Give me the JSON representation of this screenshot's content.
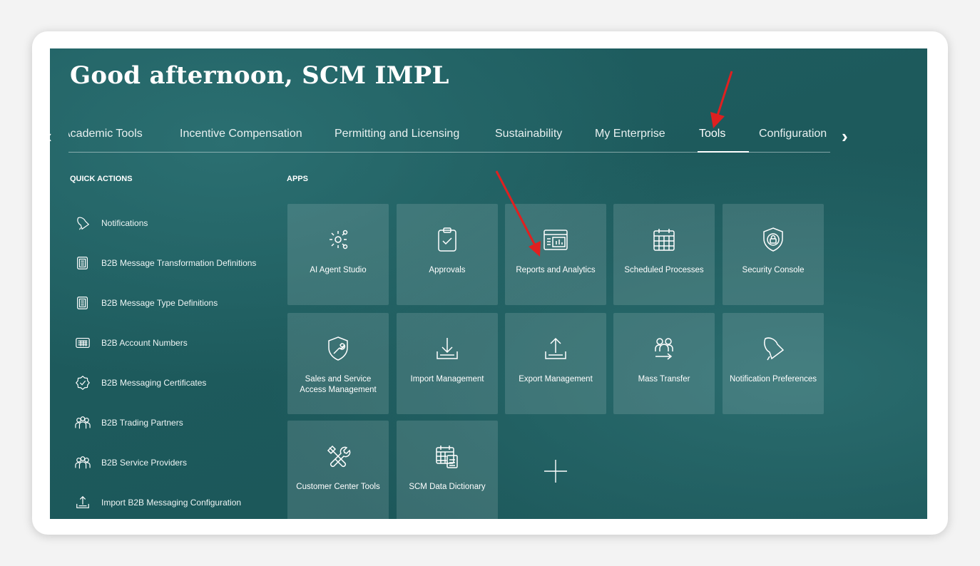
{
  "greeting": "Good afternoon, SCM IMPL",
  "tabs": [
    {
      "label": "Academic Tools"
    },
    {
      "label": "Incentive Compensation"
    },
    {
      "label": "Permitting and Licensing"
    },
    {
      "label": "Sustainability"
    },
    {
      "label": "My Enterprise"
    },
    {
      "label": "Tools",
      "active": true
    },
    {
      "label": "Configuration"
    }
  ],
  "quick_actions": {
    "heading": "QUICK ACTIONS",
    "items": [
      {
        "label": "Notifications",
        "icon": "bell-icon"
      },
      {
        "label": "B2B Message Transformation Definitions",
        "icon": "document-stack-icon"
      },
      {
        "label": "B2B Message Type Definitions",
        "icon": "document-stack-icon"
      },
      {
        "label": "B2B Account Numbers",
        "icon": "keypad-icon"
      },
      {
        "label": "B2B Messaging Certificates",
        "icon": "certificate-badge-icon"
      },
      {
        "label": "B2B Trading Partners",
        "icon": "people-group-icon"
      },
      {
        "label": "B2B Service Providers",
        "icon": "people-group-icon"
      },
      {
        "label": "Import B2B Messaging Configuration",
        "icon": "upload-tray-icon"
      }
    ]
  },
  "apps": {
    "heading": "APPS",
    "tiles": [
      {
        "label": "AI Agent Studio",
        "icon": "agent-network-icon"
      },
      {
        "label": "Approvals",
        "icon": "clipboard-check-icon"
      },
      {
        "label": "Reports and Analytics",
        "icon": "report-chart-icon"
      },
      {
        "label": "Scheduled Processes",
        "icon": "calendar-grid-icon"
      },
      {
        "label": "Security Console",
        "icon": "shield-lock-icon"
      },
      {
        "label": "Sales and Service Access Management",
        "icon": "shield-wrench-icon"
      },
      {
        "label": "Import Management",
        "icon": "download-tray-icon"
      },
      {
        "label": "Export Management",
        "icon": "upload-tray-icon"
      },
      {
        "label": "Mass Transfer",
        "icon": "people-transfer-icon"
      },
      {
        "label": "Notification Preferences",
        "icon": "bell-icon"
      },
      {
        "label": "Customer Center Tools",
        "icon": "tools-icon"
      },
      {
        "label": "SCM Data Dictionary",
        "icon": "calendar-document-icon"
      }
    ],
    "add_icon": "plus-icon"
  },
  "nav_icons": {
    "prev": "chevron-left-icon",
    "next": "chevron-right-icon"
  },
  "colors": {
    "background": "#1d5a5c",
    "annotation_arrow": "#e02020"
  }
}
